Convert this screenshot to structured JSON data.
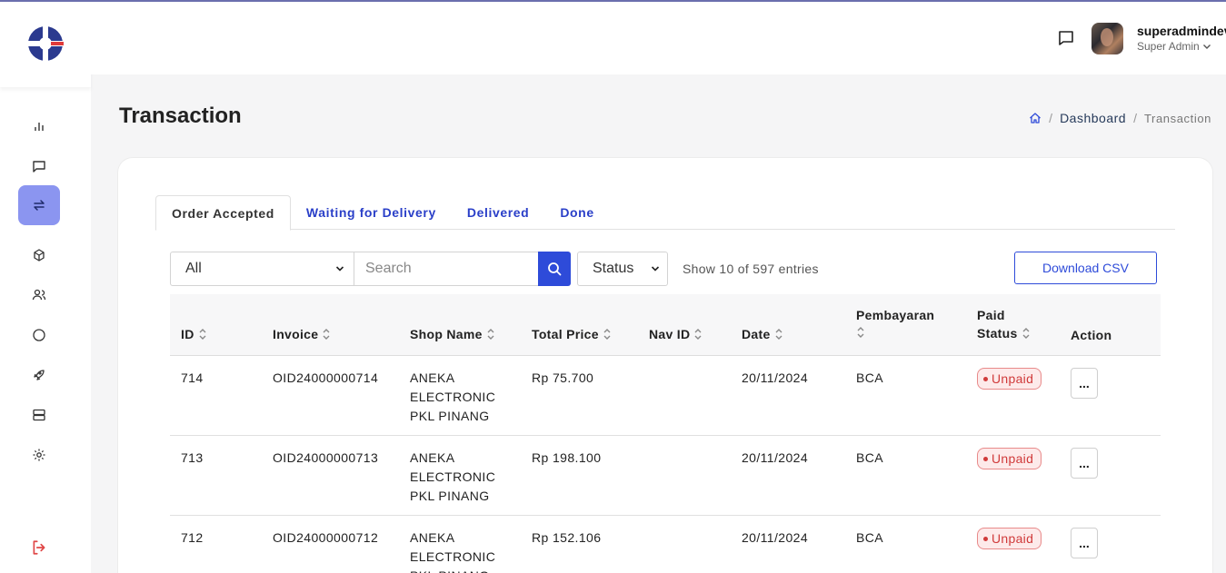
{
  "header": {
    "user_name": "superadmindev",
    "user_role": "Super Admin"
  },
  "page": {
    "title": "Transaction",
    "breadcrumb": {
      "dashboard": "Dashboard",
      "current": "Transaction",
      "separator": "/"
    }
  },
  "tabs": [
    {
      "label": "Order Accepted",
      "active": true
    },
    {
      "label": "Waiting for Delivery",
      "active": false
    },
    {
      "label": "Delivered",
      "active": false
    },
    {
      "label": "Done",
      "active": false
    }
  ],
  "toolbar": {
    "filter_value": "All",
    "search_placeholder": "Search",
    "status_value": "Status",
    "entries_text": "Show 10 of 597 entries",
    "download_label": "Download CSV"
  },
  "table": {
    "headers": {
      "id": "ID",
      "invoice": "Invoice",
      "shop_name": "Shop Name",
      "total_price": "Total Price",
      "nav_id": "Nav ID",
      "date": "Date",
      "payment_line1": "Pembayaran",
      "paid_status_line1": "Paid",
      "paid_status_line2": "Status",
      "action": "Action"
    },
    "rows": [
      {
        "id": "714",
        "invoice": "OID24000000714",
        "shop_name": "ANEKA ELECTRONIC PKL PINANG",
        "total_price": "Rp 75.700",
        "nav_id": "",
        "date": "20/11/2024",
        "payment": "BCA",
        "paid_status": "Unpaid",
        "action": "..."
      },
      {
        "id": "713",
        "invoice": "OID24000000713",
        "shop_name": "ANEKA ELECTRONIC PKL PINANG",
        "total_price": "Rp 198.100",
        "nav_id": "",
        "date": "20/11/2024",
        "payment": "BCA",
        "paid_status": "Unpaid",
        "action": "..."
      },
      {
        "id": "712",
        "invoice": "OID24000000712",
        "shop_name": "ANEKA ELECTRONIC PKL PINANG",
        "total_price": "Rp 152.106",
        "nav_id": "",
        "date": "20/11/2024",
        "payment": "BCA",
        "paid_status": "Unpaid",
        "action": "..."
      }
    ]
  },
  "sidebar": {
    "items": [
      {
        "icon": "bar-chart-icon"
      },
      {
        "icon": "message-icon"
      },
      {
        "icon": "transaction-icon",
        "active": true
      },
      {
        "icon": "box-icon"
      },
      {
        "icon": "users-icon"
      },
      {
        "icon": "circle-icon"
      },
      {
        "icon": "rocket-icon"
      },
      {
        "icon": "server-icon"
      },
      {
        "icon": "gear-icon"
      }
    ],
    "logout_icon": "logout-icon"
  },
  "colors": {
    "accent": "#2e4bd9",
    "active_nav": "#8b95f0",
    "unpaid": "#d03a3a",
    "logout": "#e04848"
  }
}
